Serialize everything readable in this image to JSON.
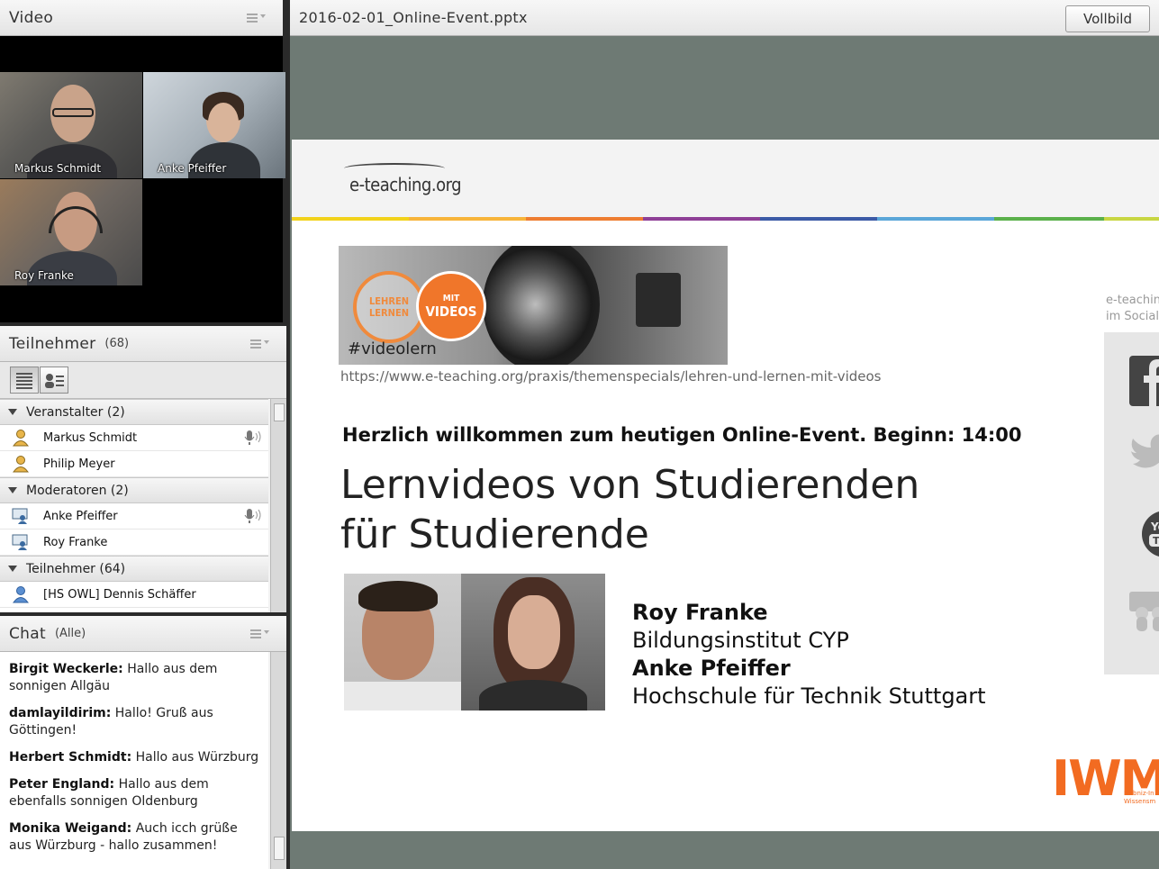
{
  "video": {
    "title": "Video",
    "cams": [
      {
        "name": "Markus Schmidt"
      },
      {
        "name": "Anke Pfeiffer"
      },
      {
        "name": "Roy Franke"
      }
    ]
  },
  "attendees": {
    "title": "Teilnehmer",
    "count": "(68)",
    "groups": [
      {
        "label": "Veranstalter (2)",
        "users": [
          "Markus Schmidt",
          "Philip Meyer"
        ]
      },
      {
        "label": "Moderatoren (2)",
        "users": [
          "Anke Pfeiffer",
          "Roy Franke"
        ]
      },
      {
        "label": "Teilnehmer (64)",
        "users": [
          "[HS OWL] Dennis Schäffer"
        ]
      }
    ]
  },
  "chat": {
    "title": "Chat",
    "scope": "(Alle)",
    "messages": [
      {
        "sender": "Birgit Weckerle",
        "text": " Hallo aus dem sonnigen Allgäu"
      },
      {
        "sender": "damlayildirim",
        "text": " Hallo! Gruß aus Göttingen!"
      },
      {
        "sender": "Herbert Schmidt",
        "text": " Hallo aus Würzburg"
      },
      {
        "sender": "Peter England",
        "text": " Hallo aus dem ebenfalls sonnigen Oldenburg"
      },
      {
        "sender": "Monika Weigand",
        "text": " Auch icch grüße aus Würzburg - hallo zusammen!"
      }
    ]
  },
  "share": {
    "filename": "2016-02-01_Online-Event.pptx",
    "fullscreen_label": "Vollbild",
    "slide": {
      "logo": "e-teaching.org",
      "badge_left_1": "LEHREN",
      "badge_left_2": "LERNEN",
      "badge_right_1": "MIT",
      "badge_right_2": "VIDEOS",
      "hashtag": "#videolern",
      "url": "https://www.e-teaching.org/praxis/themenspecials/lehren-und-lernen-mit-videos",
      "welcome": "Herzlich willkommen zum heutigen Online-Event. Beginn: 14:00",
      "title_line1": "Lernvideos von Studierenden",
      "title_line2": "für Studierende",
      "speaker1_name": "Roy Franke",
      "speaker1_org": "Bildungsinstitut CYP",
      "speaker2_name": "Anke Pfeiffer",
      "speaker2_org": "Hochschule für Technik Stuttgart",
      "social_caption_1": "e-teachin",
      "social_caption_2": "im Social",
      "iwm": "IWM",
      "iwm_sub_1": "Leibniz-In",
      "iwm_sub_2": "Wissensm"
    },
    "colorbar": [
      "#f2d21b",
      "#f7b43a",
      "#ee7d31",
      "#8e3f96",
      "#3b5aa6",
      "#5aa6d8",
      "#5ab04a",
      "#c8d642"
    ]
  }
}
